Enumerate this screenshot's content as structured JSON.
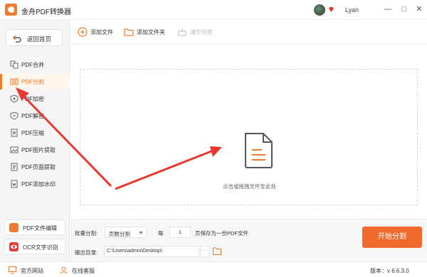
{
  "window": {
    "title": "金舟PDF转换器",
    "username": "Lyan",
    "minimize_glyph": "—",
    "maximize_glyph": "□",
    "close_glyph": "✕"
  },
  "sidebar": {
    "back_label": "返回首页",
    "items": [
      {
        "label": "PDF合并",
        "icon": "merge-icon"
      },
      {
        "label": "PDF分割",
        "icon": "split-icon",
        "active": true
      },
      {
        "label": "PDF加密",
        "icon": "encrypt-icon"
      },
      {
        "label": "PDF解密",
        "icon": "decrypt-icon"
      },
      {
        "label": "PDF压缩",
        "icon": "compress-icon"
      },
      {
        "label": "PDF图片提取",
        "icon": "image-extract-icon"
      },
      {
        "label": "PDF页面提取",
        "icon": "page-extract-icon"
      },
      {
        "label": "PDF添加水印",
        "icon": "watermark-icon"
      }
    ],
    "bottom": [
      {
        "label": "PDF文件编辑",
        "icon": "pdf-editor-icon"
      },
      {
        "label": "OCR文字识别",
        "icon": "ocr-icon"
      }
    ]
  },
  "toolbar": {
    "add_file": "添加文件",
    "add_folder": "添加文件夹",
    "clear_list": "清空列表"
  },
  "dropzone": {
    "hint": "点击或拖拽文件至此处"
  },
  "settings": {
    "batch_split_label": "批量分割:",
    "split_mode": "页数分割",
    "every_label": "每",
    "every_value": "1",
    "save_as_label": "页保存为一份PDF文件",
    "output_label": "输出目录:",
    "output_path": "C:\\Users\\admin\\Desktop\\",
    "more_glyph": "···",
    "start_button": "开始分割"
  },
  "status": {
    "website": "官方网站",
    "support": "在线客服",
    "version": "版本：v 6.6.3.0"
  },
  "colors": {
    "accent": "#f07b2d",
    "start_button": "#f06a2d",
    "annotation": "#e8382f"
  }
}
